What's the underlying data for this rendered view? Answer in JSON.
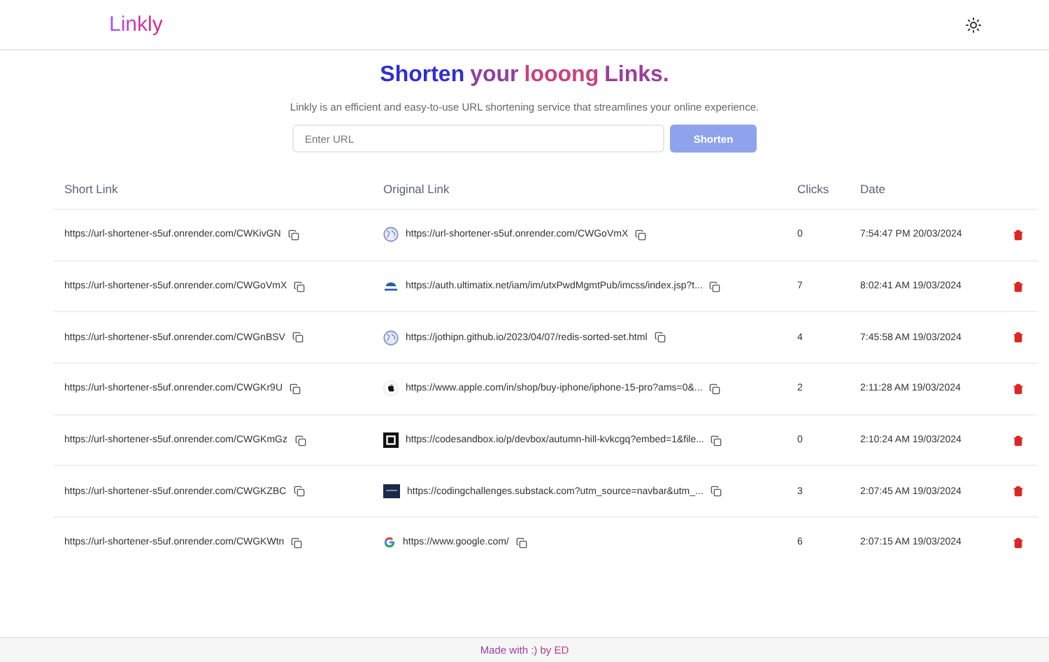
{
  "header": {
    "logo": "Linkly"
  },
  "hero": {
    "title_parts": [
      "Shorten",
      "your",
      "looong",
      "Links."
    ],
    "subtitle": "Linkly is an efficient and easy-to-use URL shortening service that streamlines your online experience.",
    "input": {
      "placeholder": "Enter URL"
    },
    "button": "Shorten"
  },
  "table": {
    "columns": [
      "Short Link",
      "Original Link",
      "Clicks",
      "Date"
    ],
    "rows": [
      {
        "short": "https://url-shortener-s5uf.onrender.com/CWKivGN",
        "kind": "globe",
        "original": "https://url-shortener-s5uf.onrender.com/CWGoVmX",
        "clicks": "0",
        "date": "7:54:47 PM 20/03/2024"
      },
      {
        "short": "https://url-shortener-s5uf.onrender.com/CWGoVmX",
        "kind": "emblem",
        "original": "https://auth.ultimatix.net/iam/im/utxPwdMgmtPub/imcss/index.jsp?t...",
        "clicks": "7",
        "date": "8:02:41 AM 19/03/2024"
      },
      {
        "short": "https://url-shortener-s5uf.onrender.com/CWGnBSV",
        "kind": "globe",
        "original": "https://jothipn.github.io/2023/04/07/redis-sorted-set.html",
        "clicks": "4",
        "date": "7:45:58 AM 19/03/2024"
      },
      {
        "short": "https://url-shortener-s5uf.onrender.com/CWGKr9U",
        "kind": "apple",
        "original": "https://www.apple.com/in/shop/buy-iphone/iphone-15-pro?ams=0&...",
        "clicks": "2",
        "date": "2:11:28 AM 19/03/2024"
      },
      {
        "short": "https://url-shortener-s5uf.onrender.com/CWGKmGz",
        "kind": "square",
        "original": "https://codesandbox.io/p/devbox/autumn-hill-kvkcgq?embed=1&file...",
        "clicks": "0",
        "date": "2:10:24 AM 19/03/2024"
      },
      {
        "short": "https://url-shortener-s5uf.onrender.com/CWGKZBC",
        "kind": "dark",
        "original": "https://codingchallenges.substack.com?utm_source=navbar&utm_...",
        "clicks": "3",
        "date": "2:07:45 AM 19/03/2024"
      },
      {
        "short": "https://url-shortener-s5uf.onrender.com/CWGKWtn",
        "kind": "google",
        "original": "https://www.google.com/",
        "clicks": "6",
        "date": "2:07:15 AM 19/03/2024"
      }
    ]
  },
  "footer": {
    "text": "Made with :) by ED"
  }
}
